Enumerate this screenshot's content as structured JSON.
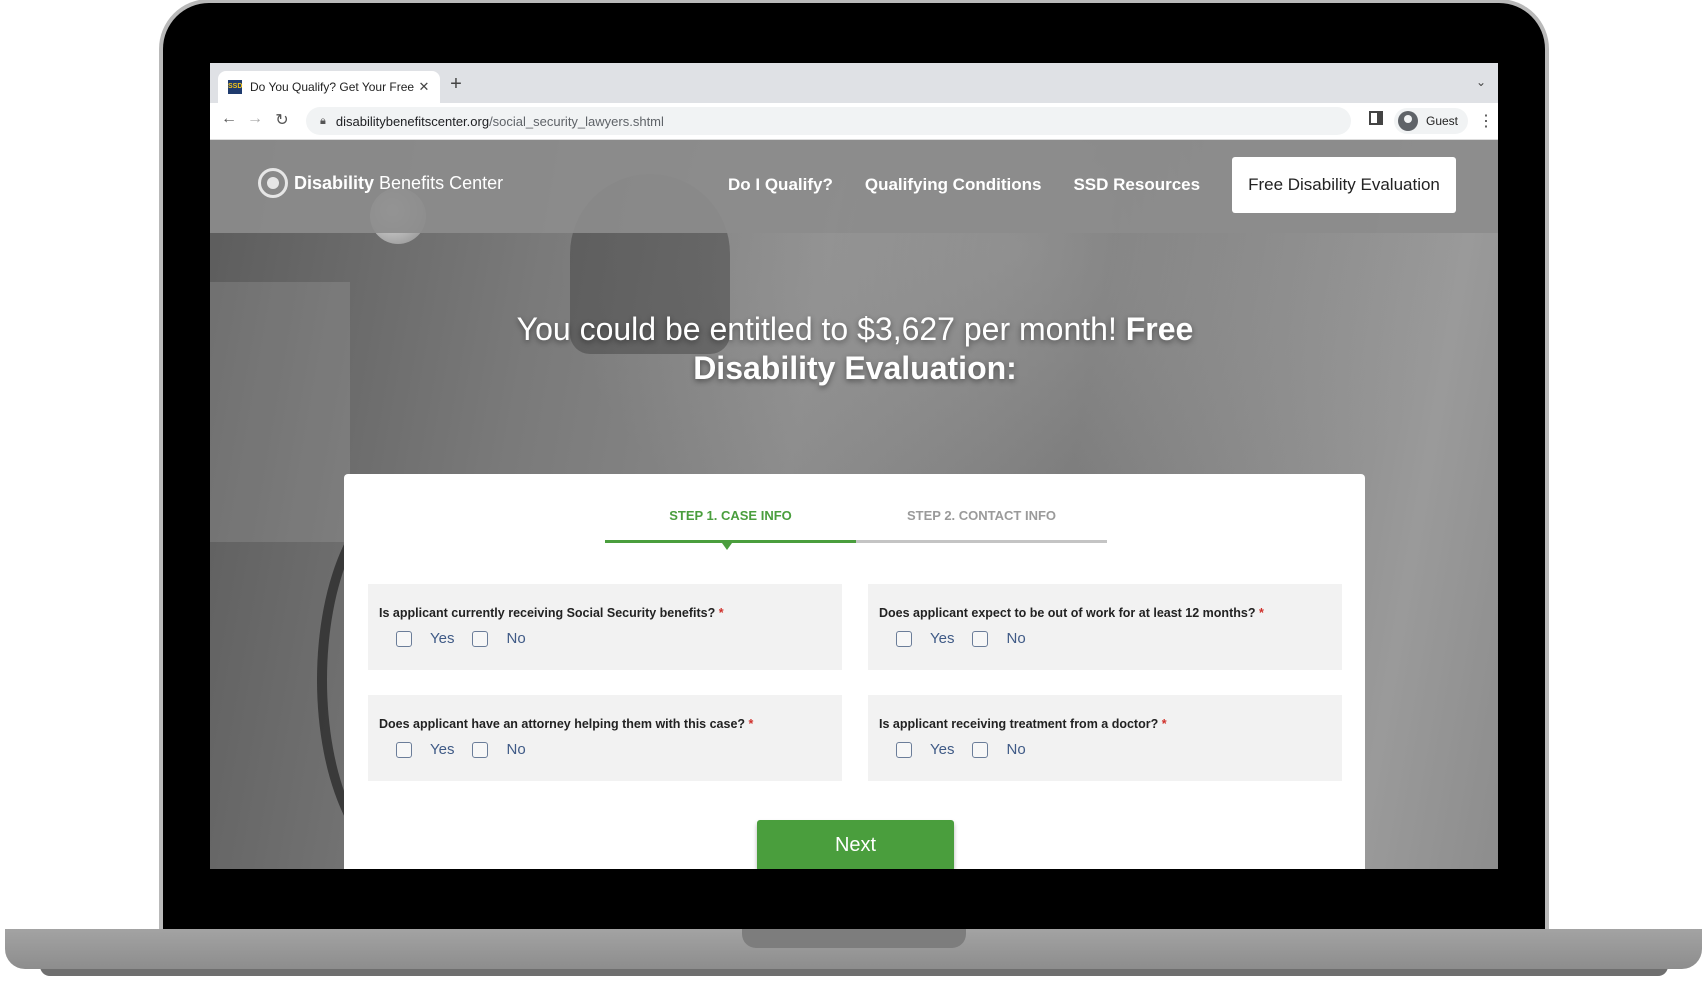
{
  "browser": {
    "tab_title": "Do You Qualify? Get Your Free",
    "favicon_text": "SSD",
    "url_domain": "disabilitybenefitscenter.org",
    "url_path": "/social_security_lawyers.shtml",
    "profile_label": "Guest"
  },
  "site": {
    "logo_bold": "Disability",
    "logo_rest": "Benefits Center",
    "nav": [
      "Do I Qualify?",
      "Qualifying Conditions",
      "SSD Resources"
    ],
    "cta": "Free Disability Evaluation"
  },
  "hero": {
    "title_regular": "You could be entitled to $3,627 per month!",
    "title_bold": "Free Disability Evaluation:"
  },
  "form": {
    "steps": [
      "STEP 1. CASE INFO",
      "STEP 2. CONTACT INFO"
    ],
    "active_step": 1,
    "required_mark": "*",
    "questions": [
      {
        "label": "Is applicant currently receiving Social Security benefits?",
        "options": [
          "Yes",
          "No"
        ]
      },
      {
        "label": "Does applicant expect to be out of work for at least 12 months?",
        "options": [
          "Yes",
          "No"
        ]
      },
      {
        "label": "Does applicant have an attorney helping them with this case?",
        "options": [
          "Yes",
          "No"
        ]
      },
      {
        "label": "Is applicant receiving treatment from a doctor?",
        "options": [
          "Yes",
          "No"
        ]
      }
    ],
    "next_label": "Next"
  },
  "colors": {
    "accent_green": "#4a9e3d",
    "required_red": "#d0302a",
    "option_text": "#3f5a86"
  }
}
